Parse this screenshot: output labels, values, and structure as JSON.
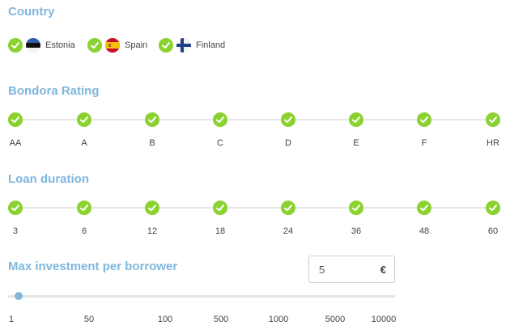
{
  "country": {
    "title": "Country",
    "items": [
      {
        "label": "Estonia",
        "checked": true,
        "flag": "estonia-flag"
      },
      {
        "label": "Spain",
        "checked": true,
        "flag": "spain-flag"
      },
      {
        "label": "Finland",
        "checked": true,
        "flag": "finland-flag"
      }
    ]
  },
  "rating": {
    "title": "Bondora Rating",
    "ticks": [
      "AA",
      "A",
      "B",
      "C",
      "D",
      "E",
      "F",
      "HR"
    ],
    "all_checked": true
  },
  "duration": {
    "title": "Loan duration",
    "ticks": [
      "3",
      "6",
      "12",
      "18",
      "24",
      "36",
      "48",
      "60"
    ],
    "all_checked": true
  },
  "max_investment": {
    "title": "Max investment per borrower",
    "value": "5",
    "currency": "€",
    "slider_ticks": [
      "1",
      "50",
      "100",
      "500",
      "1000",
      "5000",
      "10000"
    ],
    "slider_value": "5"
  },
  "colors": {
    "accent": "#7fb7dd",
    "check": "#8bd130",
    "track": "#e6e6e6"
  }
}
